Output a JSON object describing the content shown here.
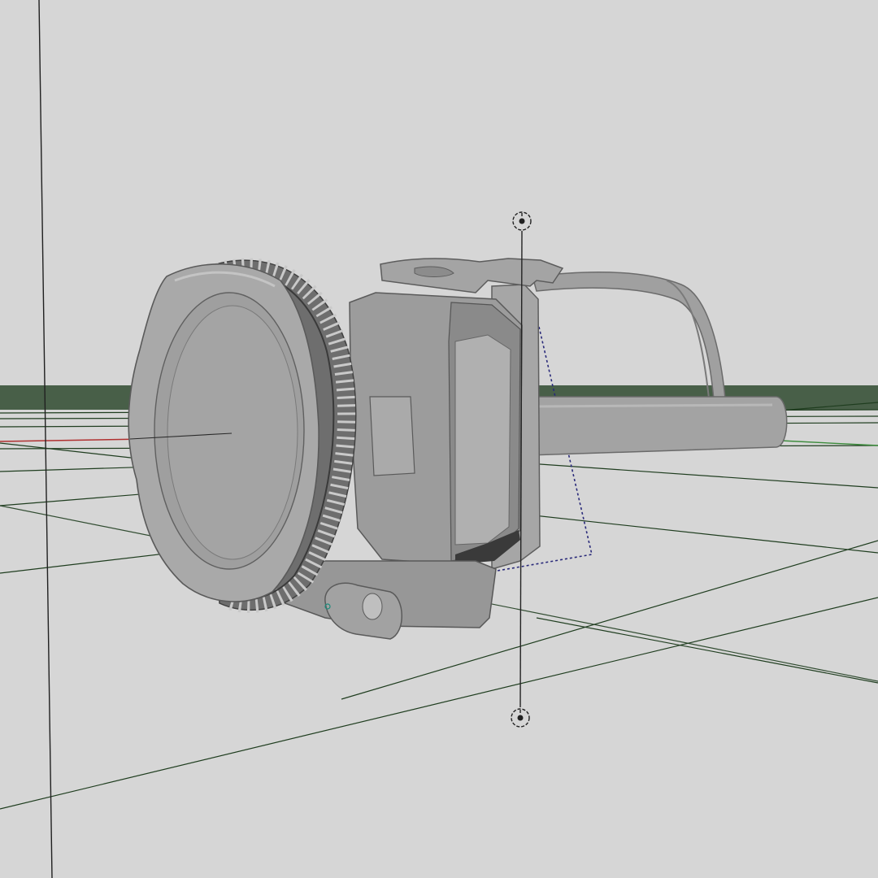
{
  "viewport": {
    "projection": "perspective",
    "background_color": "#d6d6d6",
    "grid_visible": true,
    "grid_line_color": "#1f3d1f",
    "x_axis_color": "#b03030",
    "y_axis_color": "#3c8c3c",
    "mesh_color": "#9a9a9a",
    "selection_outline_color": "#2a2a7a"
  },
  "object": {
    "shape": "headlamp",
    "parts": [
      "lens-cap",
      "knurled-ring",
      "body-housing",
      "back-plate",
      "top-clip",
      "headband-strap",
      "side-strap",
      "tilt-knob"
    ]
  },
  "gizmo": {
    "type": "vertical-transform-handle",
    "icon_top": "crosshair-target-icon",
    "icon_bottom": "crosshair-target-icon"
  }
}
